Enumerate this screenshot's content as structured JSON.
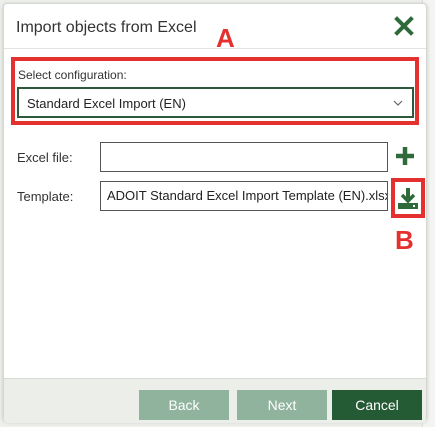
{
  "dialog": {
    "title": "Import objects from Excel",
    "close_icon": "close-x-icon"
  },
  "annotations": {
    "a_label": "A",
    "b_label": "B",
    "color": "#e53030"
  },
  "config": {
    "label": "Select configuration:",
    "selected": "Standard Excel Import (EN)"
  },
  "fields": {
    "excel_file_label": "Excel file:",
    "excel_file_value": "",
    "template_label": "Template:",
    "template_value": "ADOIT Standard Excel Import Template (EN).xlsx"
  },
  "footer": {
    "back_label": "Back",
    "next_label": "Next",
    "cancel_label": "Cancel"
  },
  "colors": {
    "brand_green": "#245a34",
    "disabled_green": "#8fb39c",
    "icon_green": "#2f6b3a"
  }
}
